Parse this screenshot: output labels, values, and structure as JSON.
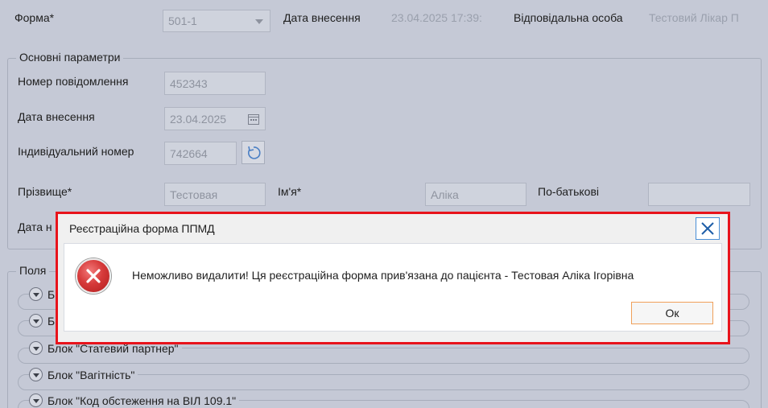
{
  "header": {
    "form_label": "Форма*",
    "form_value": "501-1",
    "entry_date_label": "Дата внесення",
    "entry_date_value": "23.04.2025 17:39:",
    "responsible_label": "Відповідальна особа",
    "responsible_value": "Тестовий Лікар П"
  },
  "main_params": {
    "legend": "Основні параметри",
    "message_number_label": "Номер повідомлення",
    "message_number_value": "452343",
    "date_label": "Дата внесення",
    "date_value": "23.04.2025",
    "individual_number_label": "Індивідуальний номер",
    "individual_number_value": "742664",
    "surname_label": "Прізвище*",
    "surname_value": "Тестовая",
    "name_label": "Ім'я*",
    "name_value": "Аліка",
    "patronymic_label": "По-батькові",
    "patronymic_value": "",
    "birth_date_label": "Дата н"
  },
  "fields_group": {
    "legend": "Поля",
    "blocks": [
      {
        "label": "Б"
      },
      {
        "label": "Б"
      },
      {
        "label": "Блок \"Статевий партнер\""
      },
      {
        "label": "Блок \"Вагітність\""
      },
      {
        "label": "Блок \"Код обстеження на ВІЛ 109.1\""
      }
    ]
  },
  "dialog": {
    "title": "Реєстраційна форма ППМД",
    "message": "Неможливо видалити! Ця реєстраційна форма прив'язана до пацієнта - Тестовая Аліка Ігорівна",
    "ok_label": "Ок",
    "border_color": "#e8131b"
  },
  "icons": {
    "close": "close-icon",
    "error": "error-icon",
    "calendar": "calendar-icon",
    "refresh": "refresh-icon",
    "chevron": "chevron-down-icon"
  }
}
